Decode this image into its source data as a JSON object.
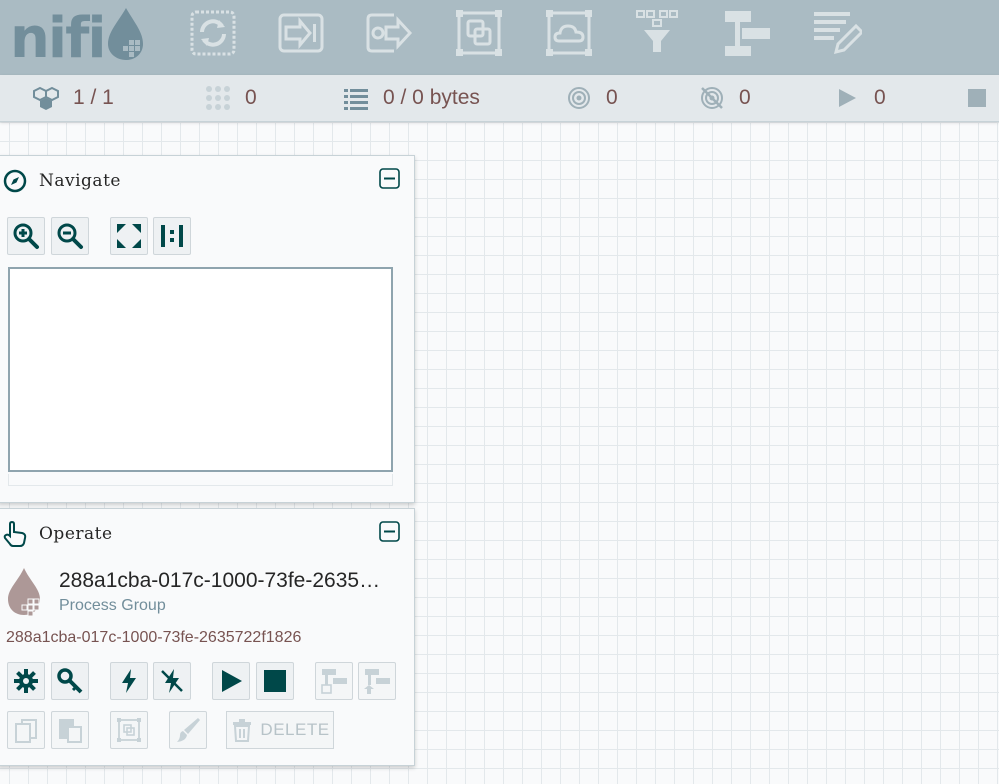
{
  "app": {
    "logo_text": "nifi",
    "colors": {
      "toolbar_bg": "#aabbc3",
      "icon_light": "#d9e1e4",
      "icon_dark": "#004849",
      "status_text": "#775351",
      "disabled": "#c7d2d7"
    }
  },
  "toolbar": {
    "buttons": [
      {
        "name": "processor-button",
        "icon": "processor-icon"
      },
      {
        "name": "input-port-button",
        "icon": "input-port-icon"
      },
      {
        "name": "output-port-button",
        "icon": "output-port-icon"
      },
      {
        "name": "process-group-button",
        "icon": "process-group-icon"
      },
      {
        "name": "remote-process-group-button",
        "icon": "remote-process-group-icon"
      },
      {
        "name": "funnel-button",
        "icon": "funnel-icon"
      },
      {
        "name": "template-button",
        "icon": "template-icon"
      },
      {
        "name": "label-button",
        "icon": "label-icon"
      }
    ]
  },
  "status": {
    "cluster": "1 / 1",
    "threads": "0",
    "queued": "0 / 0 bytes",
    "transmitting": "0",
    "not_transmitting": "0",
    "running": "0"
  },
  "navigate": {
    "title": "Navigate",
    "controls": [
      "zoom-in-icon",
      "zoom-out-icon",
      "fit-icon",
      "actual-size-icon"
    ]
  },
  "operate": {
    "title": "Operate",
    "selection_name": "288a1cba-017c-1000-73fe-2635…",
    "selection_type": "Process Group",
    "selection_id": "288a1cba-017c-1000-73fe-2635722f1826",
    "delete_label": "DELETE"
  }
}
